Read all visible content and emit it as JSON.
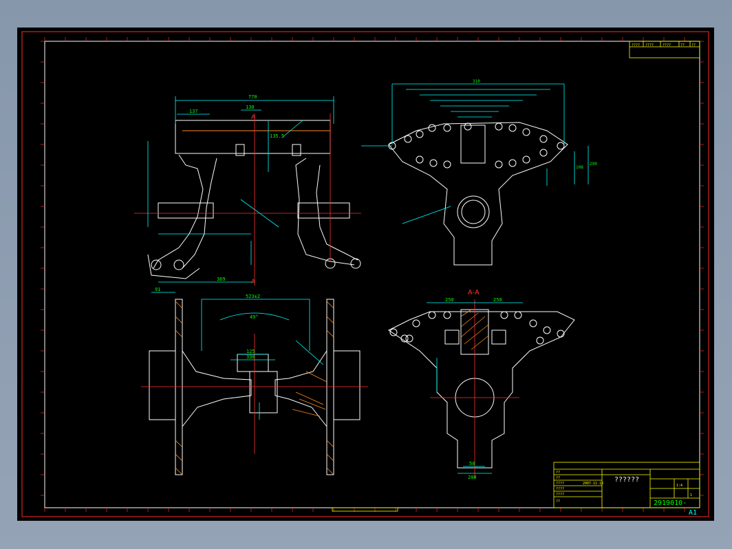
{
  "drawing": {
    "section_label": "A-A",
    "view_marker_a": "A",
    "view_marker_a2": "A",
    "sheet_size": "A1",
    "drawing_number": "2919010-",
    "title_placeholder": "??????",
    "title_block_rows": [
      "??",
      "??",
      "????",
      "????",
      "????",
      "??"
    ],
    "header_block": [
      "????",
      "????",
      "????",
      "??",
      "??"
    ],
    "scale": "1:4",
    "date": "2007-11-16",
    "sheet_no": "1"
  },
  "dimensions": {
    "top_width": "770",
    "d137": "137",
    "d130": "130",
    "d52": "52",
    "d135": "135.5",
    "d369": "369",
    "d91": "91",
    "d523": "523±2",
    "d49": "49°",
    "d125": "125",
    "d330": "330",
    "d250a": "250",
    "d250b": "250",
    "d50": "50",
    "d200": "200",
    "d290": "290",
    "d310": "310",
    "d108": "108"
  },
  "colors": {
    "frame_red": "#ff2a2a",
    "dim_cyan": "#00ffff",
    "geom_white": "#ffffff",
    "center_red": "#ff3030",
    "text_green": "#00ff00",
    "title_yellow": "#ffff00",
    "hatch_orange": "#ff8c1a"
  }
}
